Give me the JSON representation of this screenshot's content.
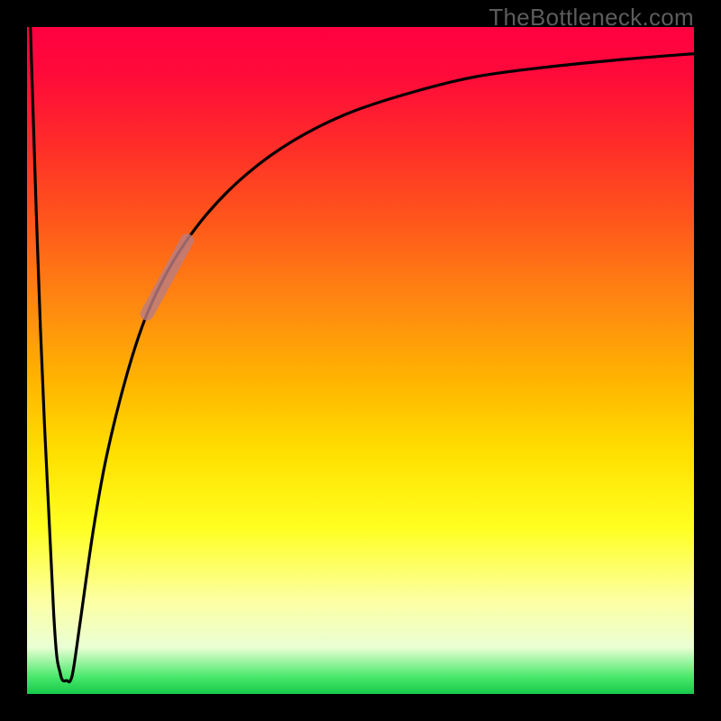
{
  "watermark": "TheBottleneck.com",
  "colors": {
    "frame": "#000000",
    "curve": "#000000",
    "highlight": "#bb7d80",
    "gradient_top": "#ff0040",
    "gradient_bottom": "#17c94a"
  },
  "chart_data": {
    "type": "line",
    "title": "",
    "xlabel": "",
    "ylabel": "",
    "xlim": [
      0,
      100
    ],
    "ylim": [
      0,
      100
    ],
    "axes_visible": false,
    "grid": false,
    "series": [
      {
        "name": "bottleneck-curve",
        "x": [
          0.5,
          2,
          4,
          5,
          6,
          6.5,
          7,
          8,
          10,
          12,
          15,
          18,
          22,
          27,
          33,
          40,
          48,
          57,
          67,
          78,
          90,
          100
        ],
        "y": [
          100,
          55,
          12,
          3,
          2,
          2,
          4,
          11,
          25,
          36,
          48,
          57,
          65,
          72,
          78,
          83,
          87,
          90,
          92.5,
          94,
          95.2,
          96
        ]
      }
    ],
    "highlight_segment": {
      "series": "bottleneck-curve",
      "x_start": 18,
      "x_end": 24,
      "y_start": 57,
      "y_end": 68
    }
  }
}
